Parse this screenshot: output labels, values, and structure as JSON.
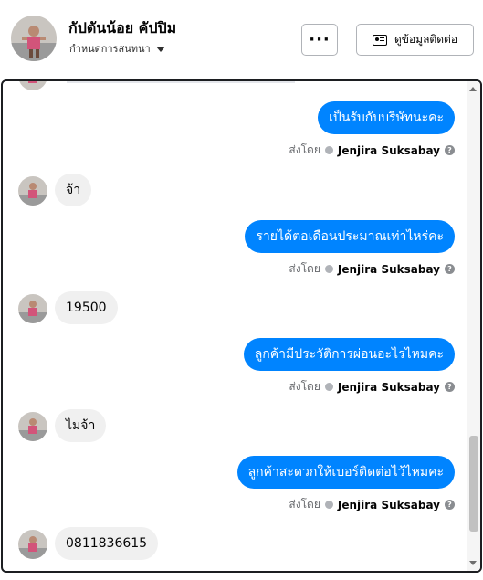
{
  "header": {
    "name": "กัปตันน้อย คัปปิม",
    "subtitle": "กำหนดการสนทนา",
    "more_label": "···",
    "info_label": "ดูข้อมูลติดต่อ"
  },
  "messages": [
    {
      "direction": "out",
      "text": "เป็นรับกับบริษัทนะคะ",
      "sent_by_prefix": "ส่งโดย",
      "sender": "Jenjira Suksabay"
    },
    {
      "direction": "in",
      "text": "จ้า"
    },
    {
      "direction": "out",
      "text": "รายได้ต่อเดือนประมาณเท่าไหร่คะ",
      "sent_by_prefix": "ส่งโดย",
      "sender": "Jenjira Suksabay"
    },
    {
      "direction": "in",
      "text": "19500"
    },
    {
      "direction": "out",
      "text": "ลูกค้ามีประวัติการผ่อนอะไรไหมคะ",
      "sent_by_prefix": "ส่งโดย",
      "sender": "Jenjira Suksabay"
    },
    {
      "direction": "in",
      "text": "ไมจ้า"
    },
    {
      "direction": "out",
      "text": "ลูกค้าสะดวกให้เบอร์ติดต่อไว้ไหมคะ",
      "sent_by_prefix": "ส่งโดย",
      "sender": "Jenjira Suksabay"
    },
    {
      "direction": "in",
      "text": "0811836615"
    }
  ],
  "colors": {
    "outgoing_bubble": "#0084ff",
    "incoming_bubble": "#f0f0f0",
    "secondary_text": "#65676b"
  },
  "icons": {
    "avatar": "profile-photo-icon",
    "caret": "chevron-down-icon",
    "more": "more-dots-icon",
    "info": "contact-card-icon",
    "check": "check-circle-icon",
    "help": "question-icon"
  }
}
